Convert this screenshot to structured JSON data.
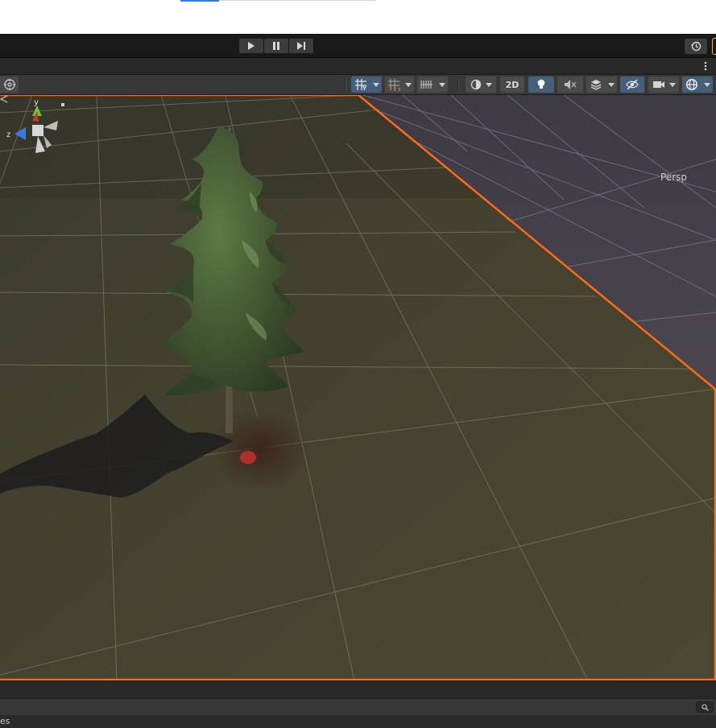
{
  "toolbar": {
    "play_icon": "play-icon",
    "pause_icon": "pause-icon",
    "step_icon": "step-icon",
    "history_icon": "history-icon"
  },
  "scene_toolbar": {
    "mode_2d_label": "2D",
    "accent_color": "#46607c"
  },
  "viewport": {
    "camera_label": "Persp",
    "gizmo_axes": {
      "y": "y",
      "z": "z"
    },
    "selection_outline_color": "#ff6a13",
    "ground_color": "#3f3d2c"
  },
  "bottom_panel": {
    "text": "es"
  }
}
